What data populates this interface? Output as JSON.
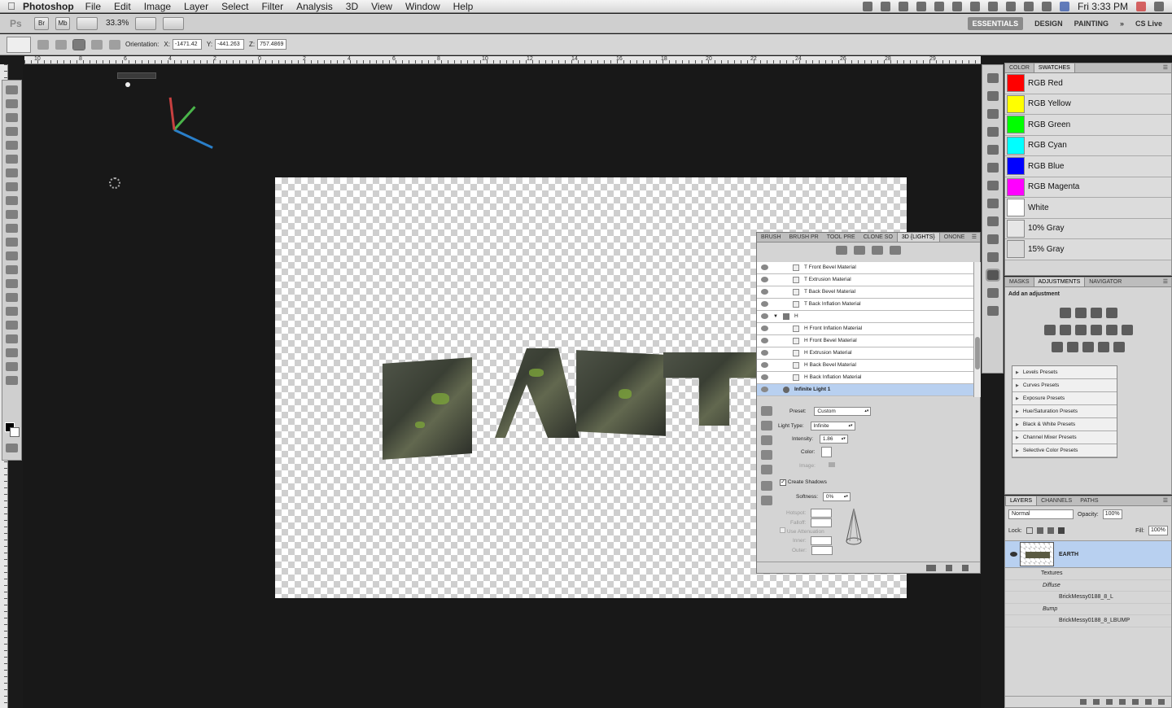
{
  "menubar": {
    "app_name": "Photoshop",
    "menus": [
      "File",
      "Edit",
      "Image",
      "Layer",
      "Select",
      "Filter",
      "Analysis",
      "3D",
      "View",
      "Window",
      "Help"
    ],
    "clock": "Fri 3:33 PM"
  },
  "appbar": {
    "ps_label": "Ps",
    "bridge_label": "Br",
    "minibridge_label": "Mb",
    "zoom": "33.3%",
    "workspaces": [
      "ESSENTIALS",
      "DESIGN",
      "PAINTING"
    ],
    "more": "»",
    "cslive": "CS Live"
  },
  "options": {
    "orientation_label": "Orientation:",
    "x_label": "X:",
    "x_value": "-1471.42",
    "y_label": "Y:",
    "y_value": "-441.263",
    "z_label": "Z:",
    "z_value": "757.4869"
  },
  "ruler_numbers": [
    "10",
    "8",
    "6",
    "4",
    "2",
    "0",
    "2",
    "4",
    "6",
    "8",
    "10",
    "12",
    "14",
    "16",
    "18",
    "20",
    "22",
    "24",
    "26",
    "28",
    "29"
  ],
  "canvas": {
    "text_3d": "EARTH"
  },
  "swatches_panel": {
    "tabs": [
      "COLOR",
      "SWATCHES"
    ],
    "items": [
      {
        "name": "RGB Red",
        "color": "#ff0000"
      },
      {
        "name": "RGB Yellow",
        "color": "#ffff00"
      },
      {
        "name": "RGB Green",
        "color": "#00ff00"
      },
      {
        "name": "RGB Cyan",
        "color": "#00ffff"
      },
      {
        "name": "RGB Blue",
        "color": "#0000ff"
      },
      {
        "name": "RGB Magenta",
        "color": "#ff00ff"
      },
      {
        "name": "White",
        "color": "#ffffff"
      },
      {
        "name": "10% Gray",
        "color": "#e6e6e6"
      },
      {
        "name": "15% Gray",
        "color": "#d9d9d9"
      }
    ]
  },
  "adjustments_panel": {
    "tabs": [
      "MASKS",
      "ADJUSTMENTS",
      "NAVIGATOR"
    ],
    "title": "Add an adjustment",
    "presets": [
      "Levels Presets",
      "Curves Presets",
      "Exposure Presets",
      "Hue/Saturation Presets",
      "Black & White Presets",
      "Channel Mixer Presets",
      "Selective Color Presets"
    ]
  },
  "layers_panel": {
    "tabs": [
      "LAYERS",
      "CHANNELS",
      "PATHS"
    ],
    "blend_mode": "Normal",
    "opacity_label": "Opacity:",
    "opacity": "100%",
    "lock_label": "Lock:",
    "fill_label": "Fill:",
    "fill": "100%",
    "layer_name": "EARTH",
    "textures_label": "Textures",
    "diffuse_label": "Diffuse",
    "diffuse_texture": "BrickMessy0188_8_L",
    "bump_label": "Bump",
    "bump_texture": "BrickMessy0188_8_LBUMP"
  },
  "panel_3d": {
    "tabs": [
      "BRUSH",
      "BRUSH PR",
      "TOOL PRE",
      "CLONE SO",
      "3D {LIGHTS}",
      "ONONE"
    ],
    "scene_rows": [
      {
        "label": "T Front Bevel Material",
        "type": "material"
      },
      {
        "label": "T Extrusion Material",
        "type": "material"
      },
      {
        "label": "T Back Bevel Material",
        "type": "material"
      },
      {
        "label": "T Back Inflation Material",
        "type": "material"
      },
      {
        "label": "H",
        "type": "group"
      },
      {
        "label": "H Front Inflation Material",
        "type": "material"
      },
      {
        "label": "H Front Bevel Material",
        "type": "material"
      },
      {
        "label": "H Extrusion Material",
        "type": "material"
      },
      {
        "label": "H Back Bevel Material",
        "type": "material"
      },
      {
        "label": "H Back Inflation Material",
        "type": "material"
      },
      {
        "label": "Infinite Light 1",
        "type": "selected"
      }
    ],
    "preset_label": "Preset:",
    "preset_value": "Custom",
    "light_type_label": "Light Type:",
    "light_type_value": "Infinite",
    "intensity_label": "Intensity:",
    "intensity_value": "1.86",
    "color_label": "Color:",
    "image_label": "Image:",
    "create_shadows_label": "Create Shadows",
    "softness_label": "Softness:",
    "softness_value": "0%",
    "hotspot_label": "Hotspot:",
    "falloff_label": "Falloff:",
    "use_attenuation_label": "Use Attenuation",
    "inner_label": "Inner:",
    "outer_label": "Outer:"
  }
}
